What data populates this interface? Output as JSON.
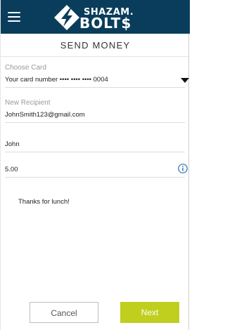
{
  "header": {
    "logo_top": "SHAZAM.",
    "logo_bottom": "BOLT$"
  },
  "page": {
    "title": "SEND MONEY"
  },
  "form": {
    "card": {
      "label": "Choose Card",
      "value": "Your card number •••• •••• •••• 0004"
    },
    "recipient": {
      "label": "New Recipient",
      "value": "JohnSmith123@gmail.com"
    },
    "name": {
      "value": "John"
    },
    "amount": {
      "value": "5.00"
    },
    "memo": {
      "value": "Thanks for lunch!"
    }
  },
  "actions": {
    "cancel_label": "Cancel",
    "next_label": "Next"
  },
  "colors": {
    "header_bg": "#0a3d5c",
    "next_button_bg": "#c0ce1e",
    "info_icon": "#2a6fb0"
  },
  "icons": [
    "menu-icon",
    "shazam-bolt-logo",
    "chevron-down-icon",
    "info-icon"
  ]
}
